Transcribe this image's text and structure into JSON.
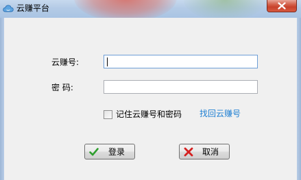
{
  "window": {
    "title": "云赚平台",
    "icon": "cloud-icon",
    "close_icon": "close-icon"
  },
  "form": {
    "account_label": "云赚号:",
    "account_value": "",
    "password_label": "密  码:",
    "password_value": "",
    "remember_checked": false,
    "remember_label": "记住云赚号和密码",
    "recover_link": "找回云赚号"
  },
  "buttons": {
    "login_label": "登录",
    "login_icon": "checkmark-icon",
    "cancel_label": "取消",
    "cancel_icon": "x-icon"
  },
  "colors": {
    "link": "#1e7fd2",
    "close_button": "#c8422c",
    "login_check": "#2e9e2e",
    "cancel_x": "#d42020"
  }
}
